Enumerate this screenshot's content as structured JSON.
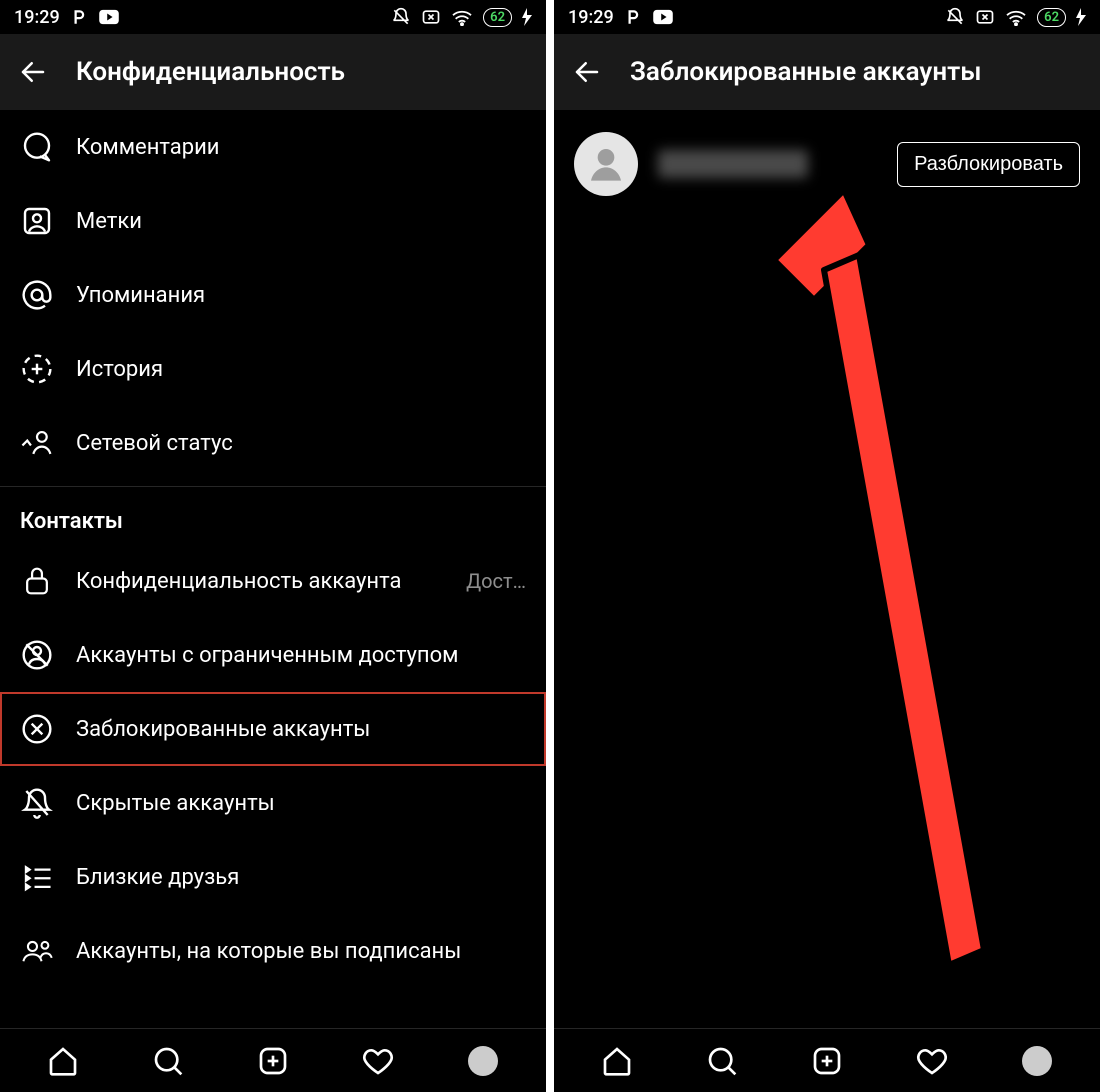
{
  "status": {
    "time": "19:29",
    "battery": "62"
  },
  "left": {
    "header_title": "Конфиденциальность",
    "items_interactions": [
      {
        "id": "comments",
        "label": "Комментарии"
      },
      {
        "id": "tags",
        "label": "Метки"
      },
      {
        "id": "mentions",
        "label": "Упоминания"
      },
      {
        "id": "story",
        "label": "История"
      },
      {
        "id": "activity-status",
        "label": "Сетевой статус"
      }
    ],
    "section_contacts": "Контакты",
    "items_contacts": [
      {
        "id": "account-privacy",
        "label": "Конфиденциальность аккаунта",
        "trail": "Дост…"
      },
      {
        "id": "restricted-accounts",
        "label": "Аккаунты с ограниченным доступом"
      },
      {
        "id": "blocked-accounts",
        "label": "Заблокированные аккаунты",
        "highlight": true
      },
      {
        "id": "muted-accounts",
        "label": "Скрытые аккаунты"
      },
      {
        "id": "close-friends",
        "label": "Близкие друзья"
      },
      {
        "id": "following-accounts",
        "label": "Аккаунты, на которые вы подписаны"
      }
    ]
  },
  "right": {
    "header_title": "Заблокированные аккаунты",
    "unblock_label": "Разблокировать"
  }
}
